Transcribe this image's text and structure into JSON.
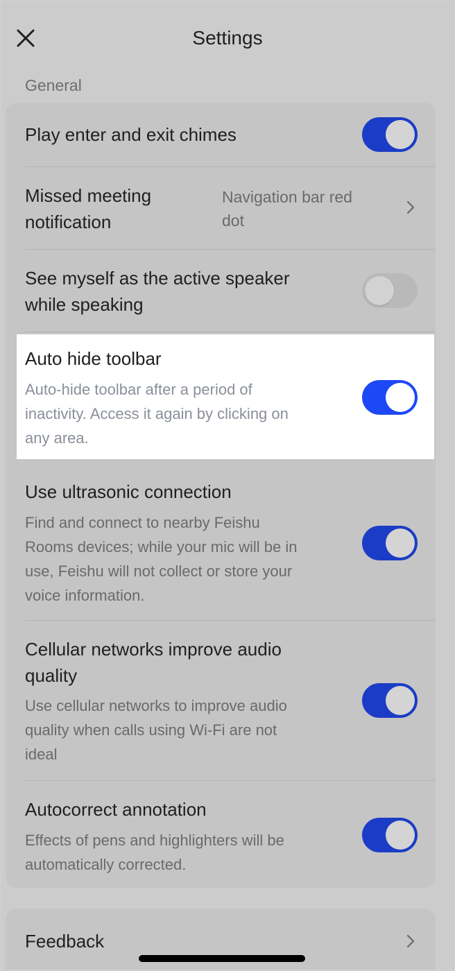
{
  "header": {
    "title": "Settings",
    "close_icon": "close-icon"
  },
  "sections": {
    "general_label": "General"
  },
  "rows": {
    "chimes": {
      "title": "Play enter and exit chimes",
      "toggle": true
    },
    "missed": {
      "title_line1": "Missed meeting",
      "title_line2": "notification",
      "value_line1": "Navigation bar red",
      "value_line2": "dot"
    },
    "active_speaker": {
      "title_line1": "See myself as the active speaker",
      "title_line2": "while speaking",
      "toggle": false
    },
    "auto_hide": {
      "title": "Auto hide toolbar",
      "desc_line1": "Auto-hide toolbar after a period of",
      "desc_line2": "inactivity. Access it again by clicking on",
      "desc_line3": "any area.",
      "toggle": true
    },
    "ultrasonic": {
      "title": "Use ultrasonic connection",
      "desc_line1": "Find and connect to nearby Feishu",
      "desc_line2": "Rooms devices; while your mic will be in",
      "desc_line3": "use, Feishu will not collect or store your",
      "desc_line4": "voice information.",
      "toggle": true
    },
    "cellular": {
      "title_line1": "Cellular networks improve audio",
      "title_line2": "quality",
      "desc_line1": "Use cellular networks to improve audio",
      "desc_line2": "quality when calls using Wi-Fi are not",
      "desc_line3": "ideal",
      "toggle": true
    },
    "autocorrect": {
      "title": "Autocorrect annotation",
      "desc_line1": "Effects of pens and highlighters will be",
      "desc_line2": "automatically corrected.",
      "toggle": true
    },
    "feedback": {
      "title": "Feedback"
    }
  },
  "colors": {
    "toggle_on": "#1d48f5",
    "toggle_on_dimmed": "#1b3cc6",
    "highlight_bg": "#ffffff"
  }
}
